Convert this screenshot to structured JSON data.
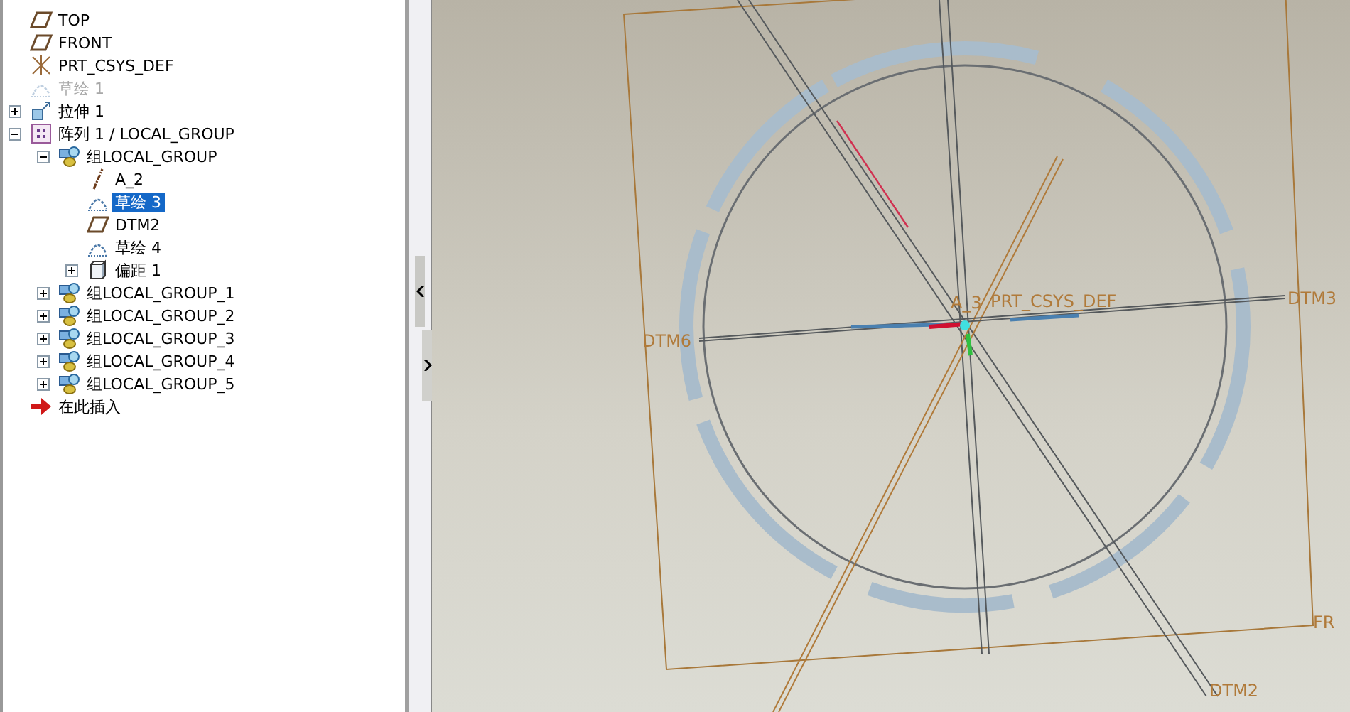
{
  "model_tree": [
    {
      "label": "TOP",
      "kind": "plane",
      "selected": false,
      "disabled": false
    },
    {
      "label": "FRONT",
      "kind": "plane",
      "selected": false,
      "disabled": false
    },
    {
      "label": "PRT_CSYS_DEF",
      "kind": "csys",
      "selected": false,
      "disabled": false
    },
    {
      "label": "草绘 1",
      "kind": "sketch",
      "selected": false,
      "disabled": true
    },
    {
      "label": "拉伸 1",
      "kind": "extrude",
      "selected": false,
      "disabled": false,
      "expanded": false
    },
    {
      "label": "阵列 1 / LOCAL_GROUP",
      "kind": "pattern",
      "selected": false,
      "disabled": false,
      "expanded": true,
      "children": [
        {
          "label": "组LOCAL_GROUP",
          "kind": "group",
          "selected": false,
          "disabled": false,
          "expanded": true,
          "children": [
            {
              "label": "A_2",
              "kind": "axis",
              "selected": false,
              "disabled": false
            },
            {
              "label": "草绘 3",
              "kind": "sketch",
              "selected": true,
              "disabled": false
            },
            {
              "label": "DTM2",
              "kind": "plane",
              "selected": false,
              "disabled": false
            },
            {
              "label": "草绘 4",
              "kind": "sketch",
              "selected": false,
              "disabled": false
            },
            {
              "label": "偏距 1",
              "kind": "offset",
              "selected": false,
              "disabled": false,
              "expanded": false
            }
          ]
        },
        {
          "label": "组LOCAL_GROUP_1",
          "kind": "group",
          "selected": false,
          "disabled": false,
          "expanded": false
        },
        {
          "label": "组LOCAL_GROUP_2",
          "kind": "group",
          "selected": false,
          "disabled": false,
          "expanded": false
        },
        {
          "label": "组LOCAL_GROUP_3",
          "kind": "group",
          "selected": false,
          "disabled": false,
          "expanded": false
        },
        {
          "label": "组LOCAL_GROUP_4",
          "kind": "group",
          "selected": false,
          "disabled": false,
          "expanded": false
        },
        {
          "label": "组LOCAL_GROUP_5",
          "kind": "group",
          "selected": false,
          "disabled": false,
          "expanded": false
        }
      ]
    },
    {
      "label": "在此插入",
      "kind": "insert",
      "selected": false,
      "disabled": false
    }
  ],
  "viewport": {
    "labels": [
      "DTM6",
      "A_3",
      "PRT_CSYS_DEF",
      "DTM3",
      "DTM2",
      "FR"
    ]
  }
}
